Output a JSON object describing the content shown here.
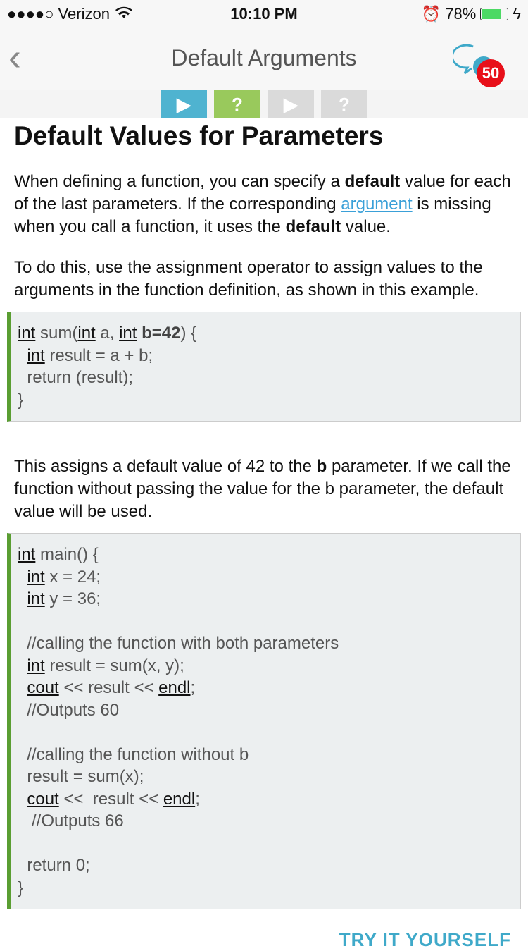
{
  "status_bar": {
    "carrier": "●●●●○ Verizon",
    "time": "10:10 PM",
    "battery": "78%",
    "battery_level": 0.78
  },
  "nav": {
    "title": "Default Arguments",
    "back_icon": "chevron-left-icon",
    "comments_badge": "50"
  },
  "steps": [
    {
      "icon": "▶",
      "color": "#4fb3d0"
    },
    {
      "icon": "?",
      "color": "#99c95c"
    },
    {
      "icon": "▶",
      "color": "#dadada"
    },
    {
      "icon": "?",
      "color": "#dadada"
    }
  ],
  "heading": "Default Values for Parameters",
  "paragraphs": [
    [
      {
        "t": "When defining a function, you can specify a "
      },
      {
        "t": "default",
        "b": 1
      },
      {
        "t": " value for each of the last parameters. If the corresponding "
      },
      {
        "t": "argument",
        "a": 1
      },
      {
        "t": " is missing when you call a function, it uses the "
      },
      {
        "t": "default",
        "b": 1
      },
      {
        "t": " value."
      }
    ],
    [
      {
        "t": "To do this, use the assignment operator to assign values to the arguments in the function definition, as shown in this example."
      }
    ],
    [
      {
        "t": "This assigns a default value of 42 to the "
      },
      {
        "t": "b",
        "b": 1
      },
      {
        "t": " parameter. If we call the function without passing the value for the b parameter, the default value will be used."
      }
    ]
  ],
  "code_blocks": [
    [
      [
        {
          "t": "int",
          "u": 1
        },
        {
          "t": " sum("
        },
        {
          "t": "int",
          "u": 1
        },
        {
          "t": " a, "
        },
        {
          "t": "int",
          "u": 1
        },
        {
          "t": " "
        },
        {
          "t": "b=42",
          "b": 1
        },
        {
          "t": ") {"
        }
      ],
      [
        {
          "t": "  "
        },
        {
          "t": "int",
          "u": 1
        },
        {
          "t": " result = a + b;"
        }
      ],
      [
        {
          "t": "  return (result);"
        }
      ],
      [
        {
          "t": "}"
        }
      ]
    ],
    [
      [
        {
          "t": "int",
          "u": 1
        },
        {
          "t": " main() {"
        }
      ],
      [
        {
          "t": "  "
        },
        {
          "t": "int",
          "u": 1
        },
        {
          "t": " x = 24;"
        }
      ],
      [
        {
          "t": "  "
        },
        {
          "t": "int",
          "u": 1
        },
        {
          "t": " y = 36;"
        }
      ],
      [
        {
          "t": ""
        }
      ],
      [
        {
          "t": "  //calling the function with both parameters"
        }
      ],
      [
        {
          "t": "  "
        },
        {
          "t": "int",
          "u": 1
        },
        {
          "t": " result = sum(x, y);"
        }
      ],
      [
        {
          "t": "  "
        },
        {
          "t": "cout",
          "u": 1
        },
        {
          "t": " << result << "
        },
        {
          "t": "endl",
          "u": 1
        },
        {
          "t": ";"
        }
      ],
      [
        {
          "t": "  //Outputs 60"
        }
      ],
      [
        {
          "t": ""
        }
      ],
      [
        {
          "t": "  //calling the function without b"
        }
      ],
      [
        {
          "t": "  result = sum(x);"
        }
      ],
      [
        {
          "t": "  "
        },
        {
          "t": "cout",
          "u": 1
        },
        {
          "t": " <<  result << "
        },
        {
          "t": "endl",
          "u": 1
        },
        {
          "t": ";"
        }
      ],
      [
        {
          "t": "   //Outputs 66"
        }
      ],
      [
        {
          "t": ""
        }
      ],
      [
        {
          "t": "  return 0;"
        }
      ],
      [
        {
          "t": "}"
        }
      ]
    ]
  ],
  "try_button": "TRY IT YOURSELF"
}
